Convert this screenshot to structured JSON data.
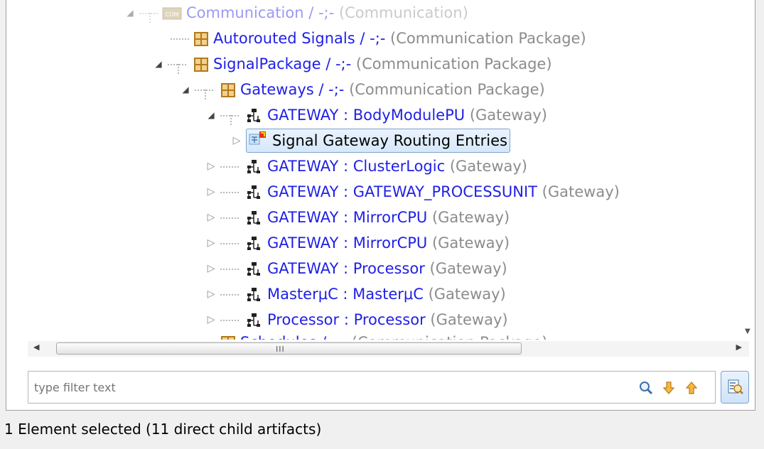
{
  "tree": {
    "rows": [
      {
        "name": "Communication / -;-",
        "type": "(Communication)",
        "icon": "communication-folder-icon"
      },
      {
        "name": "Autorouted Signals / -;-",
        "type": "(Communication Package)",
        "icon": "package-icon"
      },
      {
        "name": "SignalPackage / -;-",
        "type": "(Communication Package)",
        "icon": "package-icon"
      },
      {
        "name": "Gateways / -;-",
        "type": "(Communication Package)",
        "icon": "package-icon"
      },
      {
        "name": "GATEWAY : BodyModulePU",
        "type": "(Gateway)",
        "icon": "gateway-icon"
      },
      {
        "name": "Signal Gateway Routing Entries",
        "type": "",
        "icon": "routing-entries-icon"
      },
      {
        "name": "GATEWAY : ClusterLogic",
        "type": "(Gateway)",
        "icon": "gateway-icon"
      },
      {
        "name": "GATEWAY : GATEWAY_PROCESSUNIT",
        "type": "(Gateway)",
        "icon": "gateway-icon"
      },
      {
        "name": "GATEWAY : MirrorCPU",
        "type": "(Gateway)",
        "icon": "gateway-icon"
      },
      {
        "name": "GATEWAY : MirrorCPU",
        "type": "(Gateway)",
        "icon": "gateway-icon"
      },
      {
        "name": "GATEWAY : Processor",
        "type": "(Gateway)",
        "icon": "gateway-icon"
      },
      {
        "name": "MasterμC : MasterμC",
        "type": "(Gateway)",
        "icon": "gateway-icon"
      },
      {
        "name": "Processor : Processor",
        "type": "(Gateway)",
        "icon": "gateway-icon"
      },
      {
        "name": "Schedules / -;-",
        "type": "(Communication Package)",
        "icon": "package-icon"
      }
    ]
  },
  "scrollbar": {
    "thumb_grip": "III"
  },
  "search": {
    "value": "",
    "placeholder": "type filter text"
  },
  "status": {
    "text": "1 Element selected (11 direct child artifacts)"
  },
  "colors": {
    "link": "#1f1fe6",
    "type": "#8c8c8c",
    "selection": "#d6e8fb"
  }
}
